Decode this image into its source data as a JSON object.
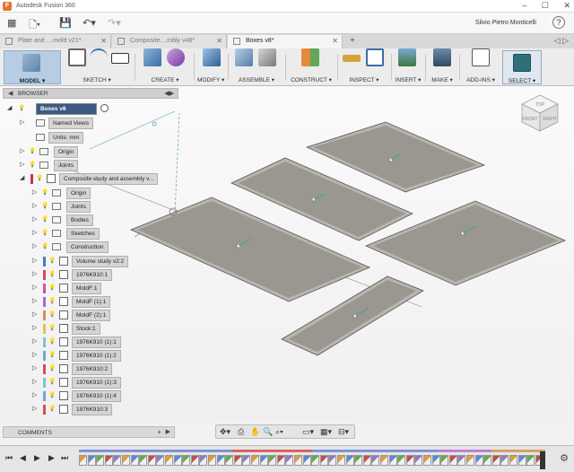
{
  "window": {
    "title": "Autodesk Fusion 360",
    "user": "Silvio Pietro Monticelli",
    "help": "?"
  },
  "tabs": [
    {
      "label": "Plate and ....mold v21*"
    },
    {
      "label": "Composite....mbly v48*"
    },
    {
      "label": "Boxes v8*"
    }
  ],
  "toolbar": {
    "model": "MODEL ▾",
    "groups": [
      "SKETCH ▾",
      "CREATE ▾",
      "MODIFY ▾",
      "ASSEMBLE ▾",
      "CONSTRUCT ▾",
      "INSPECT ▾",
      "INSERT ▾",
      "MAKE ▾",
      "ADD-INS ▾",
      "SELECT ▾"
    ]
  },
  "browser": {
    "header": "BROWSER",
    "root": "Boxes v8",
    "items": [
      "Named Views",
      "Units: mm",
      "Origin",
      "Joints",
      "Composite study and assembly v...",
      "Origin",
      "Joints",
      "Bodies",
      "Sketches",
      "Construction",
      "Volume study v2:2",
      "1976K910:1",
      "MoldF:1",
      "MoldF (1):1",
      "MoldF (2):1",
      "Stock:1",
      "1976K910 (1):1",
      "1976K910 (1):2",
      "1976K910:2",
      "1976K910 (1):3",
      "1976K910 (1):4",
      "1976K910:3"
    ]
  },
  "comments": {
    "label": "COMMENTS",
    "add": "+"
  },
  "viewcube": {
    "top": "TOP",
    "front": "FRONT",
    "right": "RIGHT"
  },
  "colors": {
    "accent": "#4a78a8",
    "plate": "#9a9690",
    "plate_border": "#b9b4ad",
    "select": "#3b7bbf"
  }
}
